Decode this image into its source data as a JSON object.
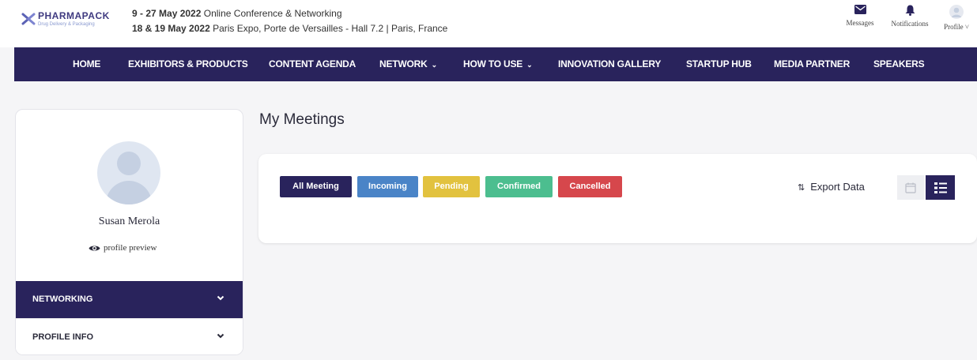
{
  "brand": {
    "name": "PHARMAPACK",
    "tagline": "Drug Delivery & Packaging",
    "colors": {
      "primary": "#29235c",
      "incoming": "#4a84c7",
      "pending": "#e2c23f",
      "confirmed": "#4cbe8f",
      "cancelled": "#d6474c"
    }
  },
  "event": {
    "online_dates": "9 - 27 May 2022",
    "online_text": "Online Conference & Networking",
    "venue_dates": "18 & 19 May 2022",
    "venue_text": "Paris Expo, Porte de Versailles - Hall 7.2 | Paris, France"
  },
  "header_actions": {
    "messages": {
      "label": "Messages",
      "icon": "envelope-icon"
    },
    "notifications": {
      "label": "Notifications",
      "icon": "bell-icon"
    },
    "profile": {
      "label": "Profile",
      "icon": "avatar-icon"
    }
  },
  "nav": {
    "items": [
      {
        "label": "HOME"
      },
      {
        "label": "EXHIBITORS & PRODUCTS"
      },
      {
        "label": "CONTENT AGENDA"
      },
      {
        "label": "NETWORK"
      },
      {
        "label": "HOW TO USE"
      },
      {
        "label": "INNOVATION GALLERY"
      },
      {
        "label": "STARTUP HUB"
      },
      {
        "label": "MEDIA PARTNER"
      },
      {
        "label": "SPEAKERS"
      }
    ]
  },
  "sidebar": {
    "user_name": "Susan Merola",
    "profile_preview": "profile preview",
    "sections": [
      {
        "label": "NETWORKING",
        "active": true
      },
      {
        "label": "PROFILE INFO",
        "active": false
      }
    ]
  },
  "main": {
    "title": "My Meetings",
    "filters": [
      {
        "label": "All Meeting"
      },
      {
        "label": "Incoming"
      },
      {
        "label": "Pending"
      },
      {
        "label": "Confirmed"
      },
      {
        "label": "Cancelled"
      }
    ],
    "export_label": "Export Data",
    "view_modes": [
      "calendar-icon",
      "list-icon"
    ],
    "selected_view": "list-icon"
  }
}
